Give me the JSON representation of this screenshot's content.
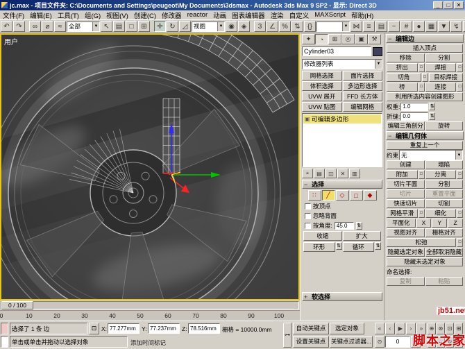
{
  "window": {
    "title": "jc.max - 项目文件夹: C:\\Documents and Settings\\peugeot\\My Documents\\3dsmax - Autodesk 3ds Max 9 SP2  - 显示: Direct 3D",
    "min": "_",
    "max": "□",
    "close": "✕"
  },
  "menu": {
    "items": [
      "文件(F)",
      "编辑(E)",
      "工具(T)",
      "组(G)",
      "视图(V)",
      "创建(C)",
      "修改器",
      "reactor",
      "动画",
      "图表编辑器",
      "渲染",
      "自定义",
      "MAXScript",
      "帮助(H)"
    ]
  },
  "toolbar": {
    "items": [
      {
        "t": "icon",
        "n": "undo-icon",
        "g": "↶"
      },
      {
        "t": "icon",
        "n": "redo-icon",
        "g": "↷"
      },
      {
        "t": "sep"
      },
      {
        "t": "icon",
        "n": "select-and-link-icon",
        "g": "∞"
      },
      {
        "t": "icon",
        "n": "unlink-selection-icon",
        "g": "⌀"
      },
      {
        "t": "icon",
        "n": "bind-to-space-warp-icon",
        "g": "≈"
      },
      {
        "t": "combo",
        "n": "selection-filter-dropdown",
        "v": "全部"
      },
      {
        "t": "icon",
        "n": "select-object-icon",
        "g": "↖"
      },
      {
        "t": "icon",
        "n": "select-by-name-icon",
        "g": "▤"
      },
      {
        "t": "icon",
        "n": "rectangular-selection-region-icon",
        "g": "□"
      },
      {
        "t": "icon",
        "n": "window-crossing-toggle-icon",
        "g": "⊞"
      },
      {
        "t": "sep"
      },
      {
        "t": "icon",
        "n": "select-and-move-icon",
        "g": "✛",
        "active": true
      },
      {
        "t": "icon",
        "n": "select-and-rotate-icon",
        "g": "↻"
      },
      {
        "t": "icon",
        "n": "select-and-scale-icon",
        "g": "◿"
      },
      {
        "t": "combo",
        "n": "reference-coordinate-dropdown",
        "v": "视图"
      },
      {
        "t": "icon",
        "n": "use-pivot-center-icon",
        "g": "◉"
      },
      {
        "t": "icon",
        "n": "select-and-manipulate-icon",
        "g": "◈"
      },
      {
        "t": "sep"
      },
      {
        "t": "icon",
        "n": "snap-toggle-3d-icon",
        "g": "3"
      },
      {
        "t": "icon",
        "n": "angle-snap-icon",
        "g": "∠"
      },
      {
        "t": "icon",
        "n": "percent-snap-icon",
        "g": "%"
      },
      {
        "t": "icon",
        "n": "spinner-snap-icon",
        "g": "⇅"
      },
      {
        "t": "icon",
        "n": "named-selection-sets-icon",
        "g": "{}"
      },
      {
        "t": "combo",
        "n": "named-selection-dropdown",
        "v": ""
      },
      {
        "t": "icon",
        "n": "mirror-icon",
        "g": "⋈"
      },
      {
        "t": "icon",
        "n": "align-icon",
        "g": "≡"
      },
      {
        "t": "icon",
        "n": "layer-manager-icon",
        "g": "▤"
      },
      {
        "t": "icon",
        "n": "curve-editor-icon",
        "g": "~"
      },
      {
        "t": "icon",
        "n": "schematic-view-icon",
        "g": "#"
      },
      {
        "t": "icon",
        "n": "material-editor-icon",
        "g": "●"
      },
      {
        "t": "icon",
        "n": "render-setup-icon",
        "g": "▦"
      },
      {
        "t": "icon",
        "n": "render-type-icon",
        "g": "▼"
      },
      {
        "t": "icon",
        "n": "quick-render-icon",
        "g": "↯"
      },
      {
        "t": "icon",
        "n": "toolbar-scroll-right-icon",
        "g": "▸"
      }
    ]
  },
  "viewport": {
    "label": "用户"
  },
  "timeline": {
    "slider": "0 / 100",
    "ticks": [
      "0",
      "10",
      "20",
      "30",
      "40",
      "50",
      "60",
      "70",
      "80",
      "90",
      "100"
    ]
  },
  "command_panel": {
    "tabs": [
      {
        "n": "tab-create",
        "g": "✦"
      },
      {
        "n": "tab-modify",
        "g": "◔",
        "active": true
      },
      {
        "n": "tab-hierarchy",
        "g": "⊞"
      },
      {
        "n": "tab-motion",
        "g": "◎"
      },
      {
        "n": "tab-display",
        "g": "▣"
      },
      {
        "n": "tab-utilities",
        "g": "⚒"
      }
    ],
    "object_name": "Cylinder03",
    "modifier_list": "修改器列表",
    "modifier_buttons": [
      "网格选择",
      "面片选择",
      "体积选择",
      "多边形选择",
      "UVW 展开",
      "FFD 长方体",
      "UVW 贴图",
      "编辑网格"
    ],
    "stack_items": [
      {
        "label": "可编辑多边形",
        "selected": true
      }
    ],
    "stack_tools": [
      {
        "n": "pin-stack-icon",
        "g": "⌖"
      },
      {
        "n": "show-end-result-icon",
        "g": "▤"
      },
      {
        "n": "make-unique-icon",
        "g": "◫"
      },
      {
        "n": "remove-modifier-icon",
        "g": "✕"
      },
      {
        "n": "configure-modifier-sets-icon",
        "g": "▥"
      }
    ],
    "selection": {
      "title": "选择",
      "subobject": [
        {
          "n": "vertex-subobject-icon",
          "g": "∷"
        },
        {
          "n": "edge-subobject-icon",
          "g": "╱",
          "active": true
        },
        {
          "n": "border-subobject-icon",
          "g": "◇"
        },
        {
          "n": "polygon-subobject-icon",
          "g": "□"
        },
        {
          "n": "element-subobject-icon",
          "g": "◆"
        }
      ],
      "checkboxes": [
        "按顶点",
        "忽略背面"
      ],
      "by_angle": "按角度:",
      "by_angle_value": "45.0",
      "shrink": "收缩",
      "grow": "扩大",
      "ring": "环形",
      "loop": "循环"
    },
    "soft_selection_title": "软选择"
  },
  "edit_panel": {
    "edit_edges": {
      "title": "编辑边",
      "items": [
        {
          "k": "row",
          "cells": [
            {
              "t": "插入顶点",
              "n": "insert-vertex-button"
            }
          ]
        },
        {
          "k": "row",
          "cells": [
            {
              "t": "移除",
              "n": "remove-button"
            },
            {
              "t": "分割",
              "n": "split-button"
            }
          ]
        },
        {
          "k": "row",
          "cells": [
            {
              "t": "挤出",
              "n": "extrude-button",
              "s": 1
            },
            {
              "t": "焊接",
              "n": "weld-button",
              "s": 1
            }
          ]
        },
        {
          "k": "row",
          "cells": [
            {
              "t": "切角",
              "n": "chamfer-button",
              "s": 1
            },
            {
              "t": "目标焊接",
              "n": "target-weld-button"
            }
          ]
        },
        {
          "k": "row",
          "cells": [
            {
              "t": "桥",
              "n": "bridge-button",
              "s": 1
            },
            {
              "t": "连接",
              "n": "connect-button",
              "s": 1
            }
          ]
        },
        {
          "k": "row",
          "cells": [
            {
              "t": "利用所选内容创建图形",
              "n": "create-shape-from-selection-button"
            }
          ]
        },
        {
          "k": "spin",
          "label": "权重:",
          "value": "1.0",
          "n": "edge-weight-field"
        },
        {
          "k": "spin",
          "label": "折缝:",
          "value": "0.0",
          "n": "edge-crease-field"
        },
        {
          "k": "row",
          "cells": [
            {
              "t": "编辑三角剖分",
              "n": "edit-triangulation-button"
            },
            {
              "t": "旋转",
              "n": "turn-button"
            }
          ]
        }
      ]
    },
    "edit_geometry": {
      "title": "编辑几何体",
      "items": [
        {
          "k": "row",
          "cells": [
            {
              "t": "重复上一个",
              "n": "repeat-last-button"
            }
          ]
        },
        {
          "k": "combo",
          "label": "约束",
          "value": "无",
          "n": "constraints-dropdown"
        },
        {
          "k": "row",
          "cells": [
            {
              "t": "创建",
              "n": "create-button"
            },
            {
              "t": "塌陷",
              "n": "collapse-button"
            }
          ]
        },
        {
          "k": "row",
          "cells": [
            {
              "t": "附加",
              "n": "attach-button",
              "s": 1
            },
            {
              "t": "分离",
              "n": "detach-button",
              "s": 1
            }
          ]
        },
        {
          "k": "row",
          "cells": [
            {
              "t": "切片平面",
              "n": "slice-plane-button"
            },
            {
              "t": "分割",
              "n": "split-toggle-button"
            }
          ]
        },
        {
          "k": "row",
          "cells": [
            {
              "t": "切片",
              "n": "slice-button",
              "d": 1
            },
            {
              "t": "重置平面",
              "n": "reset-plane-button",
              "d": 1
            }
          ]
        },
        {
          "k": "row",
          "cells": [
            {
              "t": "快速切片",
              "n": "quickslice-button"
            },
            {
              "t": "切割",
              "n": "cut-button"
            }
          ]
        },
        {
          "k": "row",
          "cells": [
            {
              "t": "网格平滑",
              "n": "meshsmooth-button",
              "s": 1
            },
            {
              "t": "细化",
              "n": "tessellate-button",
              "s": 1
            }
          ]
        },
        {
          "k": "row",
          "cells": [
            {
              "t": "平面化",
              "n": "make-planar-button",
              "f": 2
            },
            {
              "t": "X",
              "n": "planar-x-button"
            },
            {
              "t": "Y",
              "n": "planar-y-button"
            },
            {
              "t": "Z",
              "n": "planar-z-button"
            }
          ]
        },
        {
          "k": "row",
          "cells": [
            {
              "t": "视图对齐",
              "n": "view-align-button"
            },
            {
              "t": "栅格对齐",
              "n": "grid-align-button"
            }
          ]
        },
        {
          "k": "row",
          "cells": [
            {
              "t": "松弛",
              "n": "relax-button",
              "s": 1
            }
          ]
        },
        {
          "k": "row",
          "cells": [
            {
              "t": "隐藏选定对象",
              "n": "hide-selected-button"
            },
            {
              "t": "全部取消隐藏",
              "n": "unhide-all-button"
            }
          ]
        },
        {
          "k": "row",
          "cells": [
            {
              "t": "隐藏未选定对象",
              "n": "hide-unselected-button"
            }
          ]
        },
        {
          "k": "label",
          "t": "命名选择:",
          "n": "named-selections-label"
        },
        {
          "k": "row",
          "cells": [
            {
              "t": "复制",
              "n": "copy-named-selection-button",
              "d": 1
            },
            {
              "t": "粘贴",
              "n": "paste-named-selection-button",
              "d": 1
            }
          ]
        }
      ]
    }
  },
  "status": {
    "selection_status": "选择了 1 条 边",
    "x_label": "X:",
    "x": "77.277mm",
    "y_label": "Y:",
    "y": "77.237mm",
    "z_label": "Z:",
    "z": "78.516mm",
    "grid": "栅格 = 10000.0mm",
    "prompt": "单击或单击并拖动以选择对象",
    "add_time_tag": "添加时间标记",
    "auto_key": "自动关键点",
    "set_key": "设置关键点",
    "key_target": "选定对象",
    "key_filters": "关键点过滤器...",
    "frame": "0",
    "playback": [
      {
        "n": "go-to-start-icon",
        "g": "«"
      },
      {
        "n": "previous-frame-icon",
        "g": "‹"
      },
      {
        "n": "play-icon",
        "g": "▶"
      },
      {
        "n": "next-frame-icon",
        "g": "›"
      },
      {
        "n": "go-to-end-icon",
        "g": "»"
      }
    ],
    "nav": [
      {
        "n": "zoom-icon",
        "g": "⊕"
      },
      {
        "n": "zoom-all-icon",
        "g": "⊛"
      },
      {
        "n": "zoom-extents-icon",
        "g": "⊡"
      },
      {
        "n": "zoom-extents-all-icon",
        "g": "⊞"
      },
      {
        "n": "zoom-region-icon",
        "g": "□"
      },
      {
        "n": "pan-icon",
        "g": "↔"
      },
      {
        "n": "arc-rotate-icon",
        "g": "↻"
      },
      {
        "n": "maximize-viewport-toggle-icon",
        "g": "▣"
      }
    ]
  },
  "watermarks": {
    "small": "jb51.net",
    "large": "脚本之家"
  }
}
